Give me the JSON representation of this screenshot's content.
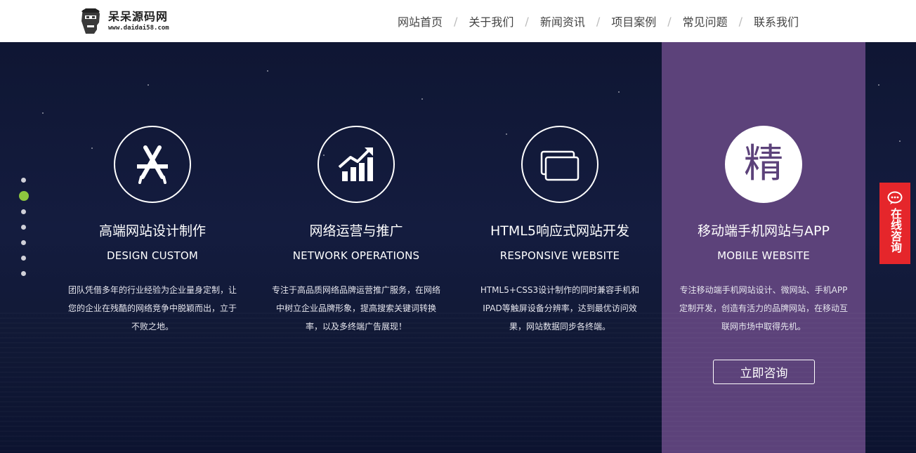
{
  "header": {
    "logo_title": "呆呆源码网",
    "logo_subtitle": "www.daidai58.com",
    "nav": [
      {
        "label": "网站首页"
      },
      {
        "label": "关于我们"
      },
      {
        "label": "新闻资讯"
      },
      {
        "label": "项目案例"
      },
      {
        "label": "常见问题"
      },
      {
        "label": "联系我们"
      }
    ],
    "separator": "/"
  },
  "services": [
    {
      "icon": "app-store-icon",
      "title": "高端网站设计制作",
      "subtitle": "DESIGN CUSTOM",
      "desc_lines": [
        "团队凭借多年的行业经验为企业量身定制，让",
        "您的企业在残酷的网络竞争中脱颖而出，立于",
        "不败之地。"
      ]
    },
    {
      "icon": "growth-chart-icon",
      "title": "网络运营与推广",
      "subtitle": "NETWORK OPERATIONS",
      "desc_lines": [
        "专注于高品质网络品牌运营推广服务，在网络",
        "中树立企业品牌形象，提高搜索关键词转换",
        "率，以及多终端广告展现！"
      ]
    },
    {
      "icon": "responsive-screens-icon",
      "title": "HTML5响应式网站开发",
      "subtitle": "RESPONSIVE WEBSITE",
      "desc_lines": [
        "HTML5+CSS3设计制作的同时兼容手机和",
        "IPAD等触屏设备分辨率，达到最优访问效",
        "果，网站数据同步各终端。"
      ]
    },
    {
      "icon": "jing-character-icon",
      "icon_char": "精",
      "title": "移动端手机网站与APP",
      "subtitle": "MOBILE WEBSITE",
      "desc_lines": [
        "专注移动端手机网站设计、微网站、手机APP",
        "定制开发，创造有活力的品牌网站，在移动互",
        "联网市场中取得先机。"
      ],
      "button_label": "立即咨询"
    }
  ],
  "slider": {
    "count": 7,
    "active_index": 1
  },
  "float_consult": {
    "label": "在线咨询"
  },
  "colors": {
    "highlight": "#5c427a",
    "active_dot": "#8dc63f",
    "consult_red": "#e5262b",
    "hero_bg": "#141c3f"
  }
}
